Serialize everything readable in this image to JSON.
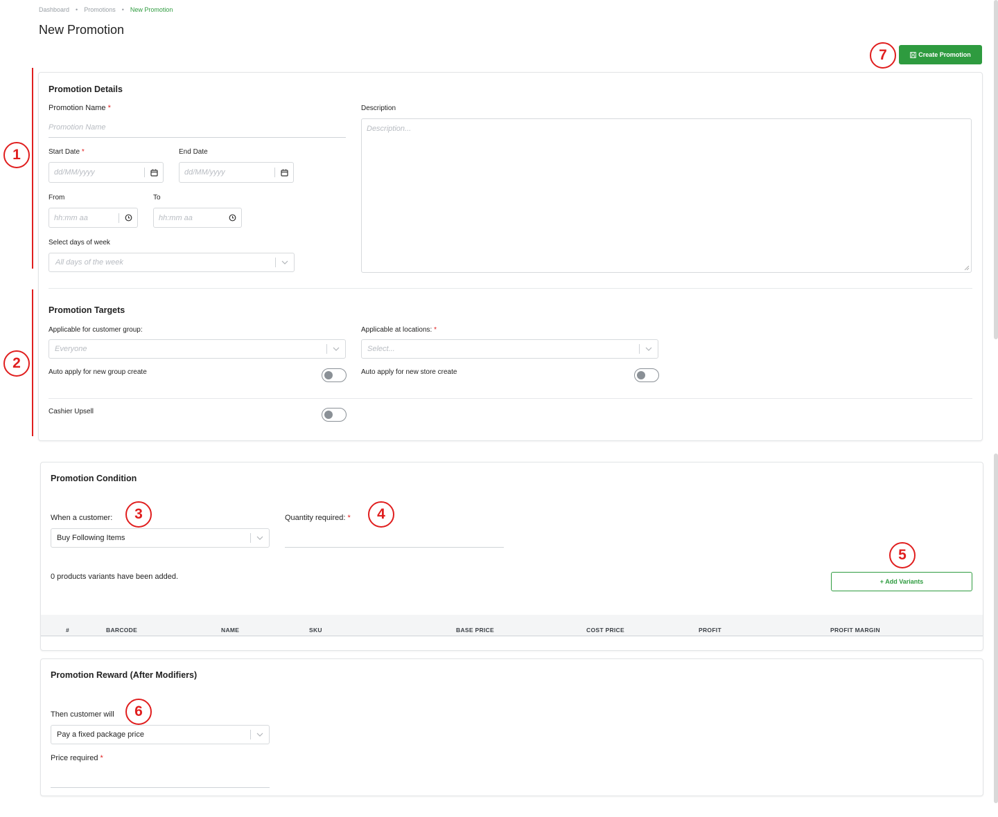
{
  "breadcrumb": {
    "items": [
      "Dashboard",
      "Promotions",
      "New Promotion"
    ],
    "separator": "•"
  },
  "page": {
    "title": "New Promotion",
    "create_button_label": "Create Promotion"
  },
  "annotations": [
    "1",
    "2",
    "3",
    "4",
    "5",
    "6",
    "7"
  ],
  "details": {
    "heading": "Promotion Details",
    "name_label": "Promotion Name",
    "name_placeholder": "Promotion Name",
    "description_label": "Description",
    "description_placeholder": "Description...",
    "start_date_label": "Start Date",
    "end_date_label": "End Date",
    "date_placeholder": "dd/MM/yyyy",
    "from_label": "From",
    "to_label": "To",
    "time_placeholder": "hh:mm aa",
    "days_label": "Select days of week",
    "days_placeholder": "All days of the week",
    "required_mark": "*"
  },
  "targets": {
    "heading": "Promotion Targets",
    "customer_group_label": "Applicable for customer group:",
    "customer_group_placeholder": "Everyone",
    "locations_label": "Applicable at locations:",
    "locations_placeholder": "Select...",
    "auto_group_label": "Auto apply for new group create",
    "auto_group_on": false,
    "auto_store_label": "Auto apply for new store create",
    "auto_store_on": false,
    "cashier_upsell_label": "Cashier Upsell",
    "cashier_upsell_on": false
  },
  "condition": {
    "heading": "Promotion Condition",
    "when_label": "When a customer:",
    "when_value": "Buy Following Items",
    "quantity_label": "Quantity required:",
    "quantity_value": "",
    "variants_summary": "0 products variants have been added.",
    "add_variants_label": "+ Add Variants",
    "table_headers": [
      "#",
      "BARCODE",
      "NAME",
      "SKU",
      "BASE PRICE",
      "COST PRICE",
      "PROFIT",
      "PROFIT MARGIN"
    ],
    "rows": []
  },
  "reward": {
    "heading": "Promotion Reward (After Modifiers)",
    "then_label": "Then customer will",
    "then_value": "Pay a fixed package price",
    "price_label": "Price required",
    "price_value": ""
  },
  "colors": {
    "accent_green": "#2e9b3f",
    "annotation_red": "#e01e1e"
  }
}
